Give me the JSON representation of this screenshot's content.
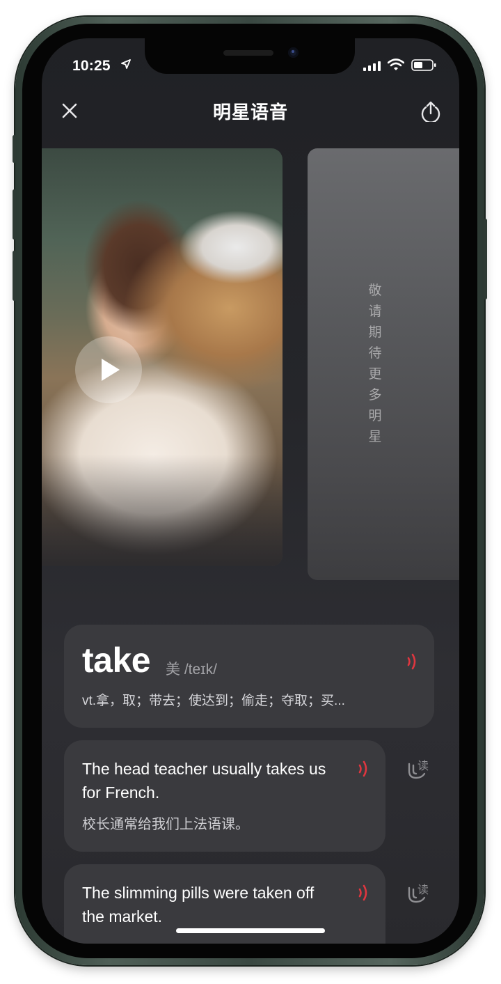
{
  "status_bar": {
    "time": "10:25"
  },
  "header": {
    "title": "明星语音"
  },
  "star": {
    "side_text": "敬请期待更多明星"
  },
  "word_card": {
    "word": "take",
    "phonetic": "美 /teɪk/",
    "meaning": "vt.拿，取；带去；使达到；偷走；夺取；买..."
  },
  "sentences": [
    {
      "en": "The head teacher usually takes us for French.",
      "zh": "校长通常给我们上法语课。"
    },
    {
      "en": "The slimming pills were taken off the market.",
      "zh": ""
    }
  ],
  "colors": {
    "accent": "#e0363f",
    "card": "#3a3a3e",
    "background": "#25262a"
  }
}
